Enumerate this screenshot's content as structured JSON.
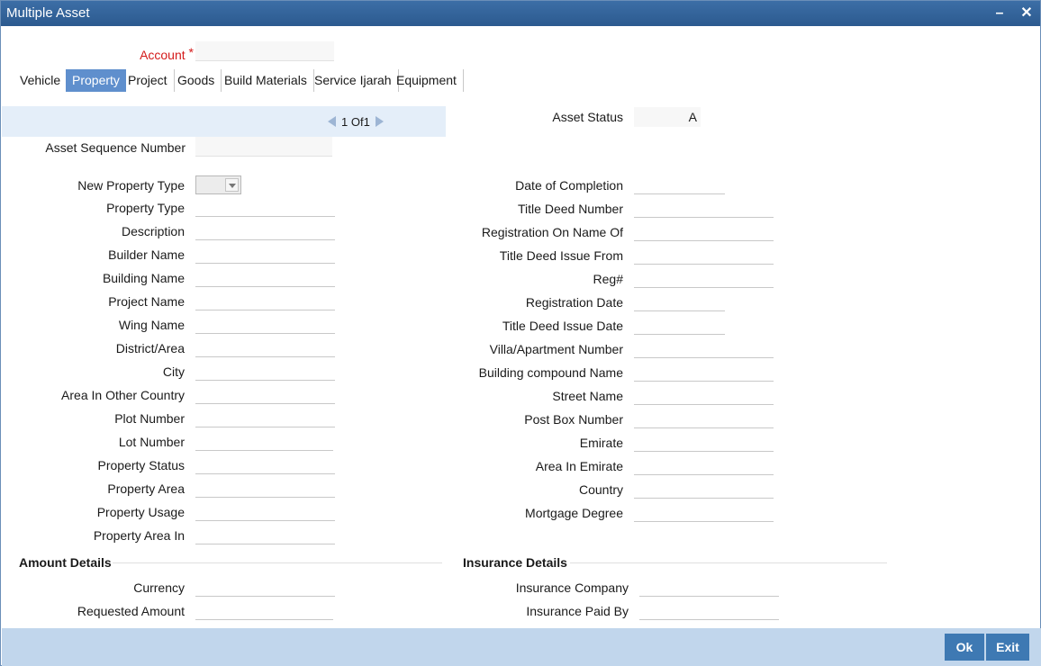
{
  "window": {
    "title": "Multiple Asset",
    "minimize_glyph": "–",
    "close_glyph": "✕"
  },
  "account": {
    "label": "Account",
    "required_mark": "*",
    "value": ""
  },
  "tabs": [
    {
      "label": "Vehicle"
    },
    {
      "label": "Property"
    },
    {
      "label": "Project"
    },
    {
      "label": "Goods"
    },
    {
      "label": "Build Materials"
    },
    {
      "label": "Service Ijarah"
    },
    {
      "label": "Equipment"
    }
  ],
  "active_tab": "Property",
  "pager": {
    "current": "1",
    "of_label": "Of",
    "total": "1"
  },
  "asset_status": {
    "label": "Asset Status",
    "value": "A"
  },
  "asset_sequence": {
    "label": "Asset Sequence Number",
    "value": ""
  },
  "left_fields": [
    {
      "label": "New Property Type",
      "value": ""
    },
    {
      "label": "Property Type",
      "value": ""
    },
    {
      "label": "Description",
      "value": ""
    },
    {
      "label": "Builder Name",
      "value": ""
    },
    {
      "label": "Building Name",
      "value": ""
    },
    {
      "label": "Project Name",
      "value": ""
    },
    {
      "label": "Wing Name",
      "value": ""
    },
    {
      "label": "District/Area",
      "value": ""
    },
    {
      "label": "City",
      "value": ""
    },
    {
      "label": "Area In Other Country",
      "value": ""
    },
    {
      "label": "Plot Number",
      "value": ""
    },
    {
      "label": "Lot Number",
      "value": ""
    },
    {
      "label": "Property Status",
      "value": ""
    },
    {
      "label": "Property Area",
      "value": ""
    },
    {
      "label": "Property Usage",
      "value": ""
    },
    {
      "label": "Property Area In",
      "value": ""
    }
  ],
  "right_fields": [
    {
      "label": "Date of Completion",
      "value": ""
    },
    {
      "label": "Title Deed Number",
      "value": ""
    },
    {
      "label": "Registration On Name Of",
      "value": ""
    },
    {
      "label": "Title Deed Issue From",
      "value": ""
    },
    {
      "label": "Reg#",
      "value": ""
    },
    {
      "label": "Registration Date",
      "value": ""
    },
    {
      "label": "Title Deed Issue Date",
      "value": ""
    },
    {
      "label": "Villa/Apartment Number",
      "value": ""
    },
    {
      "label": "Building compound Name",
      "value": ""
    },
    {
      "label": "Street Name",
      "value": ""
    },
    {
      "label": "Post Box Number",
      "value": ""
    },
    {
      "label": "Emirate",
      "value": ""
    },
    {
      "label": "Area In Emirate",
      "value": ""
    },
    {
      "label": "Country",
      "value": ""
    },
    {
      "label": "Mortgage Degree",
      "value": ""
    }
  ],
  "amount_details": {
    "title": "Amount Details",
    "fields": [
      {
        "label": "Currency",
        "value": ""
      },
      {
        "label": "Requested Amount",
        "value": ""
      }
    ]
  },
  "insurance_details": {
    "title": "Insurance Details",
    "fields": [
      {
        "label": "Insurance Company",
        "value": ""
      },
      {
        "label": "Insurance Paid By",
        "value": ""
      }
    ]
  },
  "footer": {
    "ok_label": "Ok",
    "exit_label": "Exit"
  }
}
